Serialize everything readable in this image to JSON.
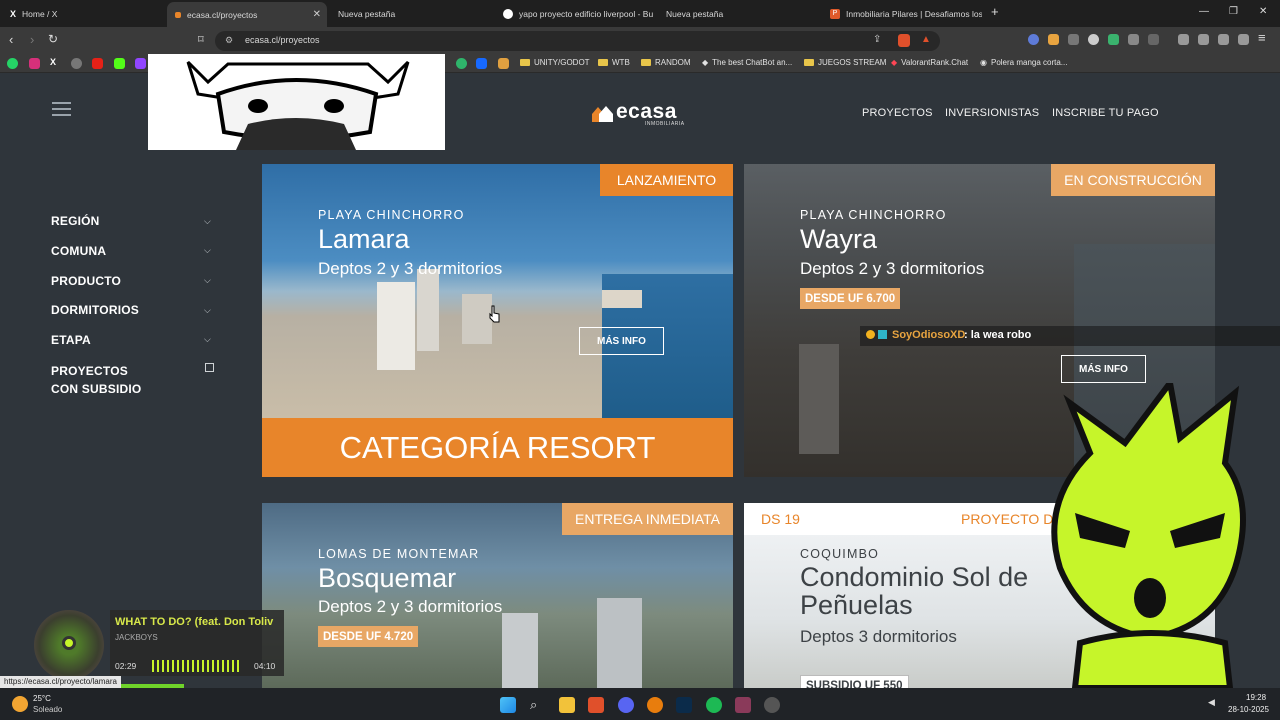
{
  "browser": {
    "tabs": [
      {
        "title": "Home / X"
      },
      {
        "title": "ecasa.cl/proyectos"
      },
      {
        "title": "Nueva pestaña"
      },
      {
        "title": "yapo proyecto edificio liverpool - Bu"
      },
      {
        "title": "Nueva pestaña"
      },
      {
        "title": "Inmobiliaria Pilares | Desafiamos los"
      }
    ],
    "new_tab": "+",
    "url": "ecasa.cl/proyectos",
    "bookmarks": [
      "UNITY/GODOT",
      "WTB",
      "RANDOM",
      "The best ChatBot an...",
      "JUEGOS STREAM",
      "ValorantRank.Chat",
      "Polera manga corta..."
    ]
  },
  "site": {
    "logo": "ecasa",
    "logo_sub": "INMOBILIARIA",
    "nav": [
      "PROYECTOS",
      "INVERSIONISTAS",
      "INSCRIBE TU PAGO"
    ]
  },
  "filters": [
    {
      "label": "REGIÓN"
    },
    {
      "label": "COMUNA"
    },
    {
      "label": "PRODUCTO"
    },
    {
      "label": "DORMITORIOS"
    },
    {
      "label": "ETAPA"
    },
    {
      "label": "PROYECTOS CON SUBSIDIO"
    }
  ],
  "cards": [
    {
      "badge": "LANZAMIENTO",
      "location": "PLAYA CHINCHORRO",
      "name": "Lamara",
      "desc": "Deptos 2 y 3 dormitorios",
      "button": "MÁS INFO",
      "banner": "CATEGORÍA RESORT"
    },
    {
      "badge": "EN CONSTRUCCIÓN",
      "location": "PLAYA CHINCHORRO",
      "name": "Wayra",
      "desc": "Deptos 2 y 3 dormitorios",
      "price": "DESDE UF 6.700",
      "button": "MÁS INFO"
    },
    {
      "badge": "ENTREGA INMEDIATA",
      "location": "LOMAS DE MONTEMAR",
      "name": "Bosquemar",
      "desc": "Deptos 2 y 3 dormitorios",
      "price": "DESDE UF 4.720"
    },
    {
      "badge_left": "DS 19",
      "badge": "PROYECTO D",
      "location": "COQUIMBO",
      "name": "Condominio Sol de Peñuelas",
      "desc": "Deptos 3 dormitorios",
      "price": "SUBSIDIO UF 550"
    }
  ],
  "chat": {
    "user": "SoyOdiosoXD",
    "message": ": la wea robo"
  },
  "music": {
    "title": "WHAT TO DO? (feat. Don Toliv",
    "artist": "JACKBOYS",
    "elapsed": "02:29",
    "total": "04:10"
  },
  "status_url": "https://ecasa.cl/proyecto/lamara",
  "taskbar": {
    "temp": "25°C",
    "weather": "Soleado",
    "time": "19:28",
    "date": "28-10-2025"
  },
  "colors": {
    "accent_orange": "#e8852a",
    "badge_tan": "#e8a765",
    "bg": "#2f353b"
  }
}
